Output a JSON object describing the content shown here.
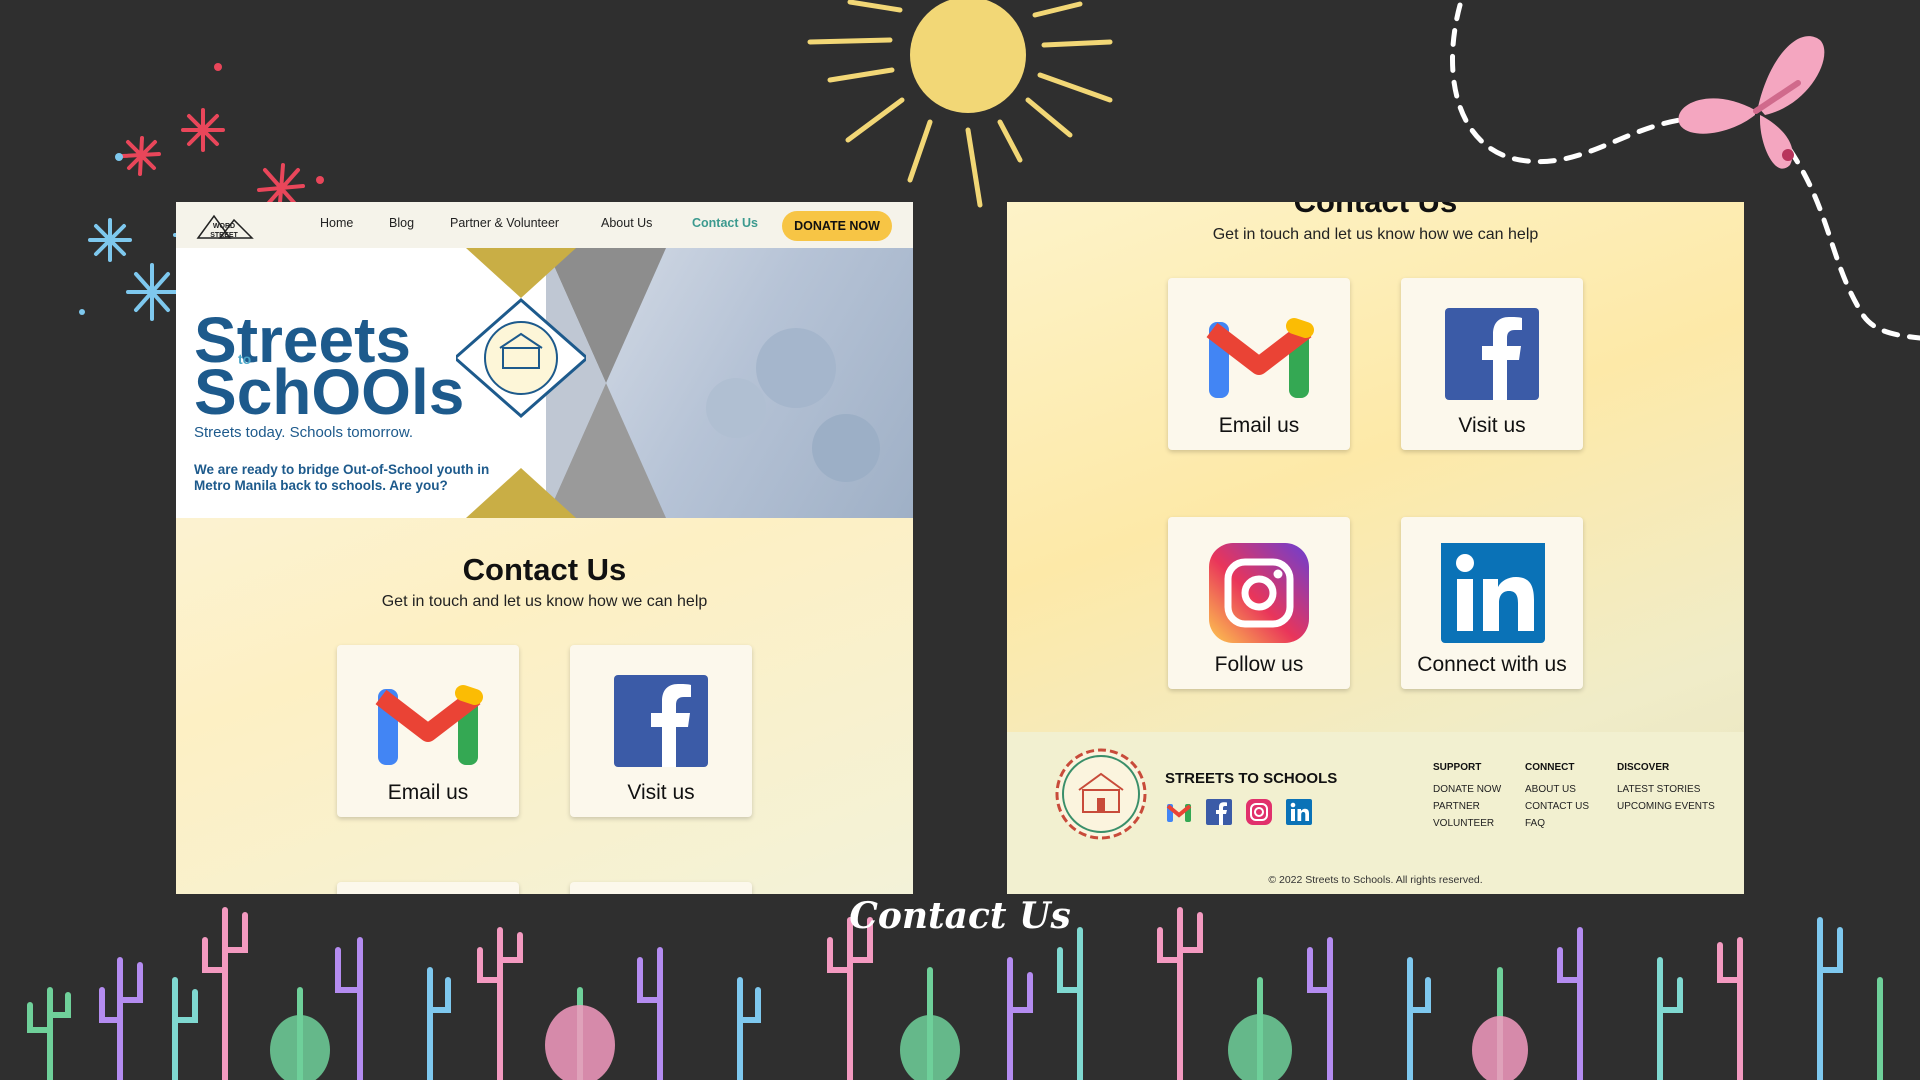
{
  "nav": {
    "items": [
      "Home",
      "Blog",
      "Partner & Volunteer",
      "About Us",
      "Contact Us"
    ],
    "donate": "DONATE NOW",
    "logo_text": "WORD STREET"
  },
  "hero": {
    "title_line1": "Streets",
    "title_small": "to",
    "title_line2": "SchOOls",
    "tagline": "Streets today. Schools tomorrow.",
    "description": "We are ready to bridge Out-of-School youth in Metro Manila back to schools. Are you?"
  },
  "contact": {
    "title": "Contact Us",
    "subtitle": "Get in touch and let us know how we can help",
    "cards": [
      {
        "label": "Email us",
        "icon": "gmail-icon"
      },
      {
        "label": "Visit us",
        "icon": "facebook-icon"
      },
      {
        "label": "Follow us",
        "icon": "instagram-icon"
      },
      {
        "label": "Connect with us",
        "icon": "linkedin-icon"
      }
    ]
  },
  "footer": {
    "brand": "STREETS TO SCHOOLS",
    "columns": [
      {
        "heading": "SUPPORT",
        "links": [
          "DONATE NOW",
          "PARTNER",
          "VOLUNTEER"
        ]
      },
      {
        "heading": "CONNECT",
        "links": [
          "ABOUT US",
          "CONTACT US",
          "FAQ"
        ]
      },
      {
        "heading": "DISCOVER",
        "links": [
          "LATEST STORIES",
          "UPCOMING EVENTS"
        ]
      }
    ],
    "copyright": "© 2022 Streets to Schools. All rights reserved."
  },
  "caption": "Contact Us",
  "colors": {
    "background": "#2f2f2f",
    "brand_blue": "#1d5a8c",
    "accent_teal": "#3c9a8f",
    "donate_yellow": "#f7c545",
    "gold": "#c9ae45"
  }
}
